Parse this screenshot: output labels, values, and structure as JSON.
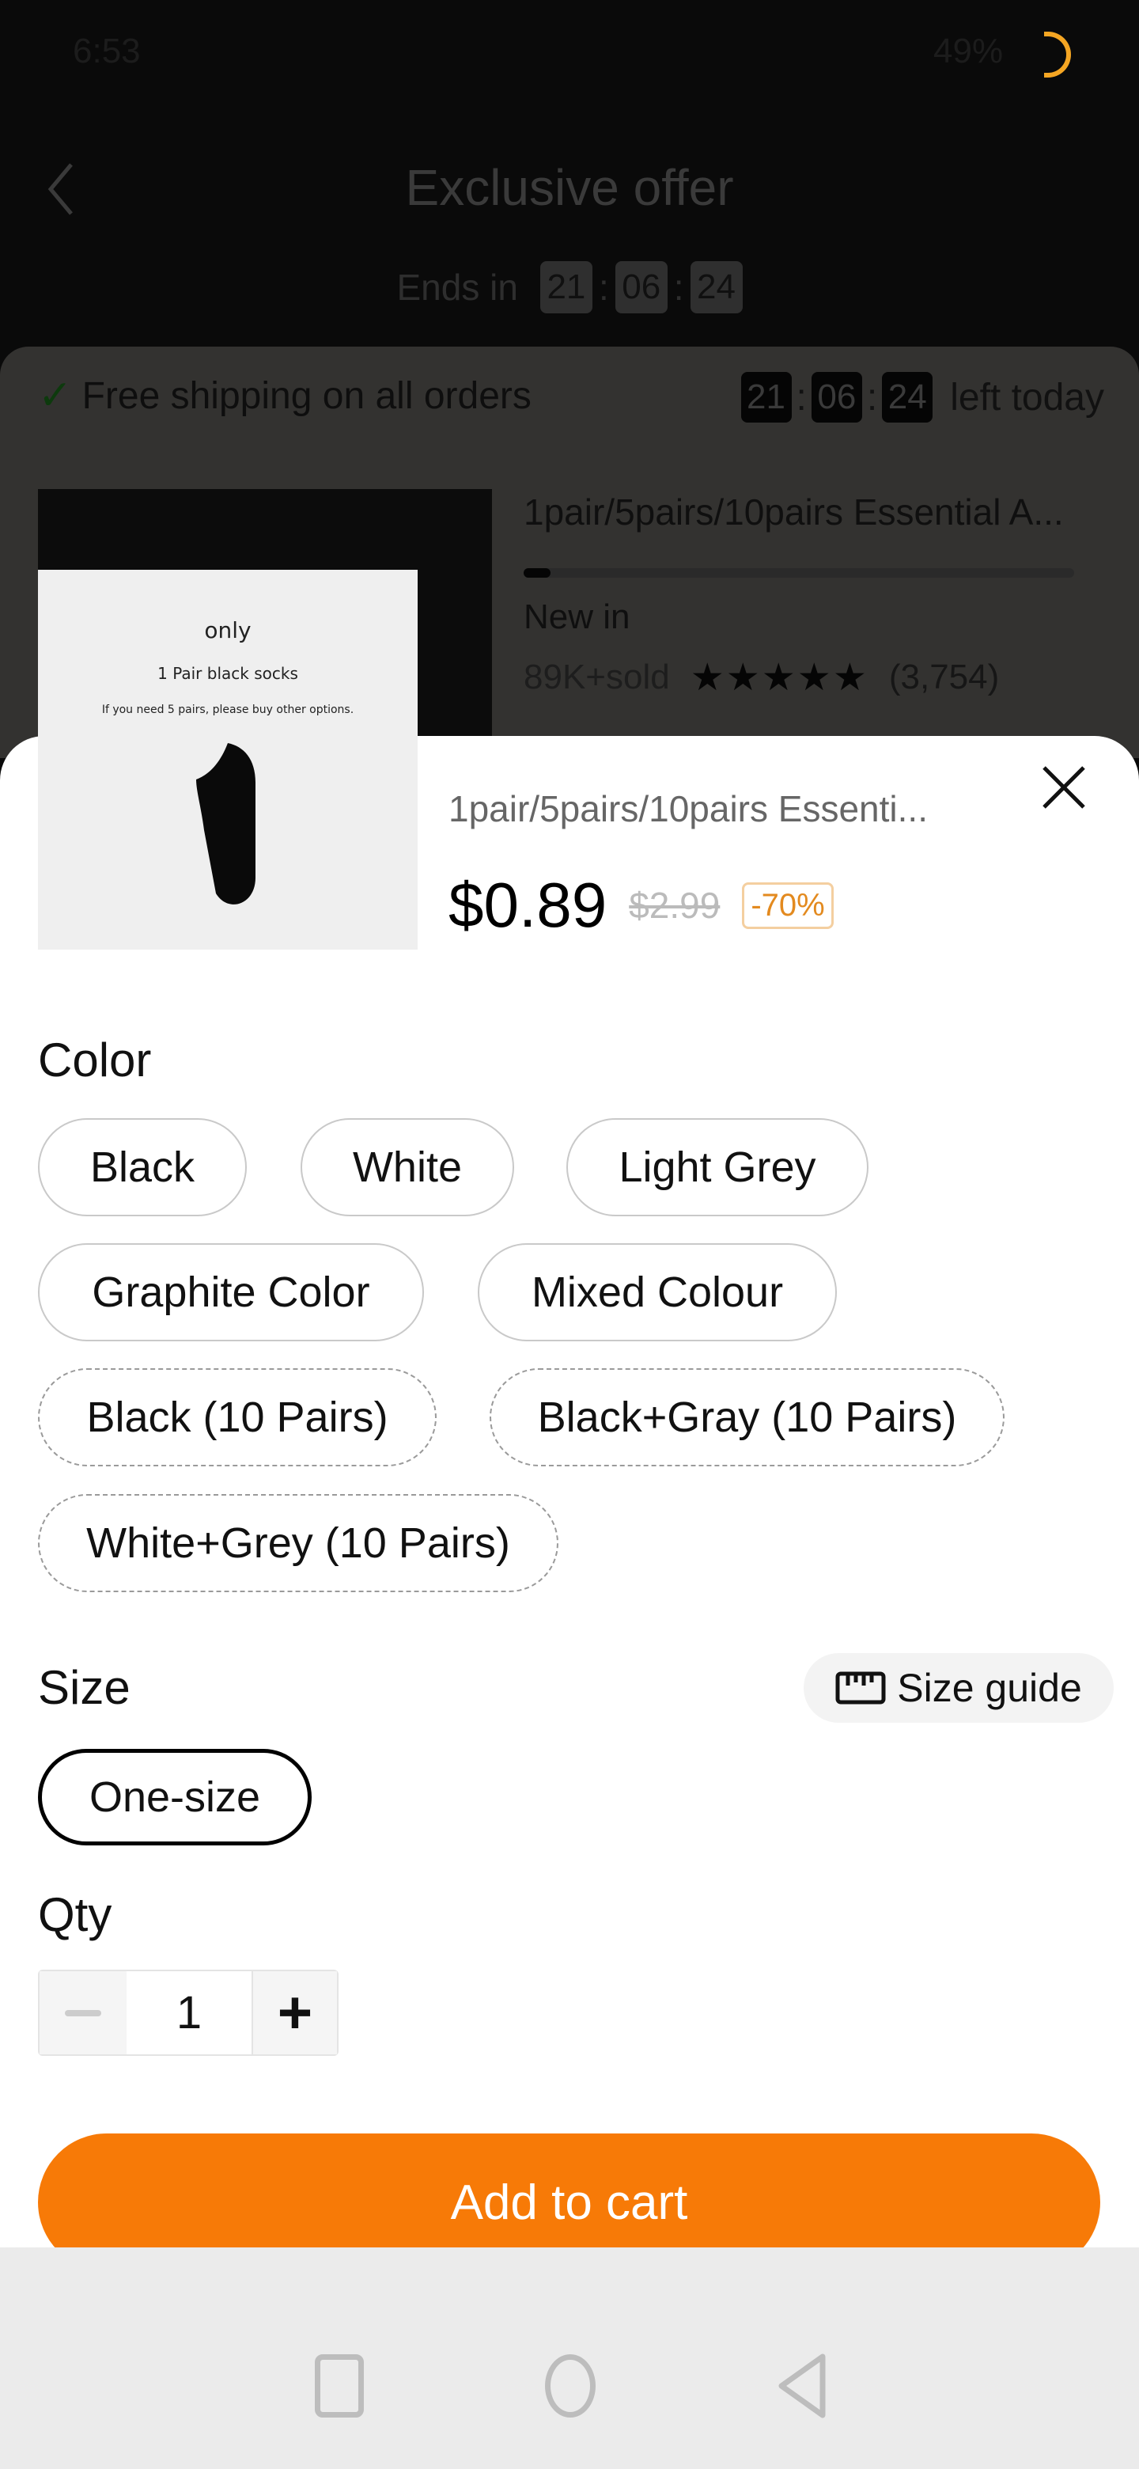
{
  "status_bar": {
    "time": "6:53",
    "battery": "49%",
    "battery_color": "#f5a623"
  },
  "header": {
    "title": "Exclusive offer",
    "ends_in_label": "Ends in",
    "timer": [
      "21",
      "06",
      "24"
    ]
  },
  "shipping_bar": {
    "text": "Free shipping on all orders",
    "timer": [
      "21",
      "06",
      "24"
    ],
    "suffix": "left today",
    "check_color": "#1a7a1a"
  },
  "background_product": {
    "title": "1pair/5pairs/10pairs Essential A...",
    "tag": "New in",
    "sold": "89K+sold",
    "rating": 4.5,
    "reviews": "(3,754)"
  },
  "sheet": {
    "image_text": {
      "line1": "only",
      "line2": "1 Pair black socks",
      "line3": "If you need 5 pairs, please buy other options."
    },
    "title": "1pair/5pairs/10pairs Essenti...",
    "price": "$0.89",
    "original_price": "$2.99",
    "discount": "-70%",
    "color_label": "Color",
    "colors": [
      {
        "label": "Black",
        "style": "solid"
      },
      {
        "label": "White",
        "style": "solid"
      },
      {
        "label": "Light Grey",
        "style": "solid"
      },
      {
        "label": "Graphite Color",
        "style": "solid"
      },
      {
        "label": "Mixed Colour",
        "style": "solid"
      },
      {
        "label": "Black (10 Pairs)",
        "style": "dashed"
      },
      {
        "label": "Black+Gray (10 Pairs)",
        "style": "dashed"
      },
      {
        "label": "White+Grey (10 Pairs)",
        "style": "dashed"
      }
    ],
    "size_label": "Size",
    "size_guide": "Size guide",
    "sizes": [
      {
        "label": "One-size",
        "selected": true
      }
    ],
    "qty_label": "Qty",
    "qty": "1",
    "add_to_cart": "Add to cart",
    "accent": "#f77a07"
  }
}
